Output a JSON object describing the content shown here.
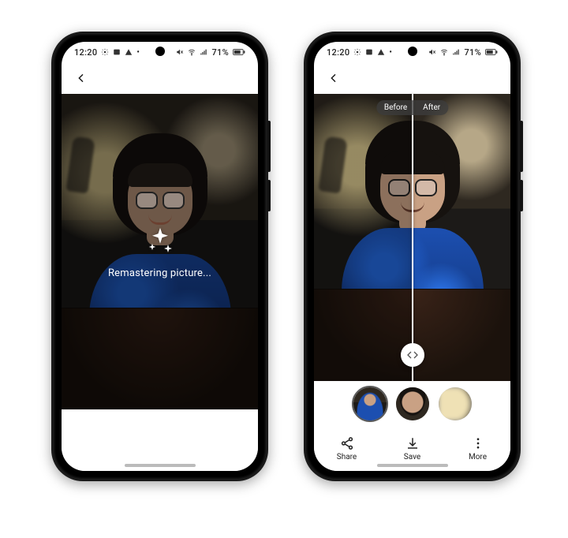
{
  "status_bar": {
    "time": "12:20",
    "battery_text": "71%"
  },
  "left_phone": {
    "processing_message": "Remastering picture..."
  },
  "right_phone": {
    "compare": {
      "before_label": "Before",
      "after_label": "After"
    },
    "actions": {
      "share": "Share",
      "save": "Save",
      "more": "More"
    }
  }
}
